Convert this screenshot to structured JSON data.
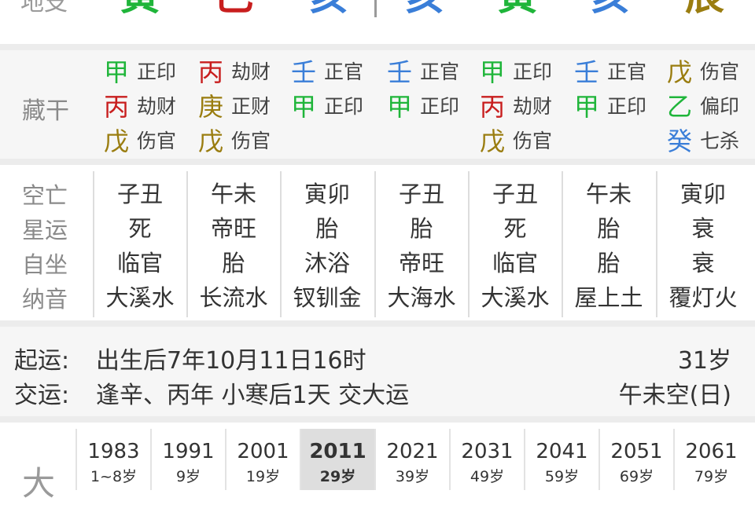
{
  "top": {
    "label": "地支",
    "branches": [
      {
        "text": "寅",
        "color": "#1fb53a"
      },
      {
        "text": "巳",
        "color": "#c81e1e"
      },
      {
        "text": "亥",
        "color": "#3a7ed8"
      },
      {
        "text": "亥",
        "color": "#3a7ed8"
      },
      {
        "text": "寅",
        "color": "#1fb53a"
      },
      {
        "text": "亥",
        "color": "#3a7ed8"
      },
      {
        "text": "辰",
        "color": "#9a7d10"
      }
    ]
  },
  "cang": {
    "label": "藏干",
    "columns": [
      [
        {
          "char": "甲",
          "god": "正印",
          "color": "c-green"
        },
        {
          "char": "丙",
          "god": "劫财",
          "color": "c-red"
        },
        {
          "char": "戊",
          "god": "伤官",
          "color": "c-olive"
        }
      ],
      [
        {
          "char": "丙",
          "god": "劫财",
          "color": "c-red"
        },
        {
          "char": "庚",
          "god": "正财",
          "color": "c-olive"
        },
        {
          "char": "戊",
          "god": "伤官",
          "color": "c-olive"
        }
      ],
      [
        {
          "char": "壬",
          "god": "正官",
          "color": "c-blue"
        },
        {
          "char": "甲",
          "god": "正印",
          "color": "c-green"
        }
      ],
      [
        {
          "char": "壬",
          "god": "正官",
          "color": "c-blue"
        },
        {
          "char": "甲",
          "god": "正印",
          "color": "c-green"
        }
      ],
      [
        {
          "char": "甲",
          "god": "正印",
          "color": "c-green"
        },
        {
          "char": "丙",
          "god": "劫财",
          "color": "c-red"
        },
        {
          "char": "戊",
          "god": "伤官",
          "color": "c-olive"
        }
      ],
      [
        {
          "char": "壬",
          "god": "正官",
          "color": "c-blue"
        },
        {
          "char": "甲",
          "god": "正印",
          "color": "c-green"
        }
      ],
      [
        {
          "char": "戊",
          "god": "伤官",
          "color": "c-olive"
        },
        {
          "char": "乙",
          "god": "偏印",
          "color": "c-green"
        },
        {
          "char": "癸",
          "god": "七杀",
          "color": "c-blue"
        }
      ]
    ]
  },
  "info": {
    "labels": [
      "空亡",
      "星运",
      "自坐",
      "纳音"
    ],
    "columns": [
      [
        "子丑",
        "死",
        "临官",
        "大溪水"
      ],
      [
        "午未",
        "帝旺",
        "胎",
        "长流水"
      ],
      [
        "寅卯",
        "胎",
        "沐浴",
        "钗钏金"
      ],
      [
        "子丑",
        "胎",
        "帝旺",
        "大海水"
      ],
      [
        "子丑",
        "死",
        "临官",
        "大溪水"
      ],
      [
        "午未",
        "胎",
        "胎",
        "屋上土"
      ],
      [
        "寅卯",
        "衰",
        "衰",
        "覆灯火"
      ]
    ]
  },
  "qiyun": {
    "start_label": "起运:",
    "start_text": "出生后7年10月11日16时",
    "age": "31岁",
    "jiao_label": "交运:",
    "jiao_text": "逢辛、丙年 小寒后1天 交大运",
    "kong": "午未空(日)"
  },
  "dayun": {
    "label": "大",
    "items": [
      {
        "year": "1983",
        "age": "1~8岁"
      },
      {
        "year": "1991",
        "age": "9岁"
      },
      {
        "year": "2001",
        "age": "19岁"
      },
      {
        "year": "2011",
        "age": "29岁",
        "active": true
      },
      {
        "year": "2021",
        "age": "39岁"
      },
      {
        "year": "2031",
        "age": "49岁"
      },
      {
        "year": "2041",
        "age": "59岁"
      },
      {
        "year": "2051",
        "age": "69岁"
      },
      {
        "year": "2061",
        "age": "79岁"
      }
    ]
  }
}
